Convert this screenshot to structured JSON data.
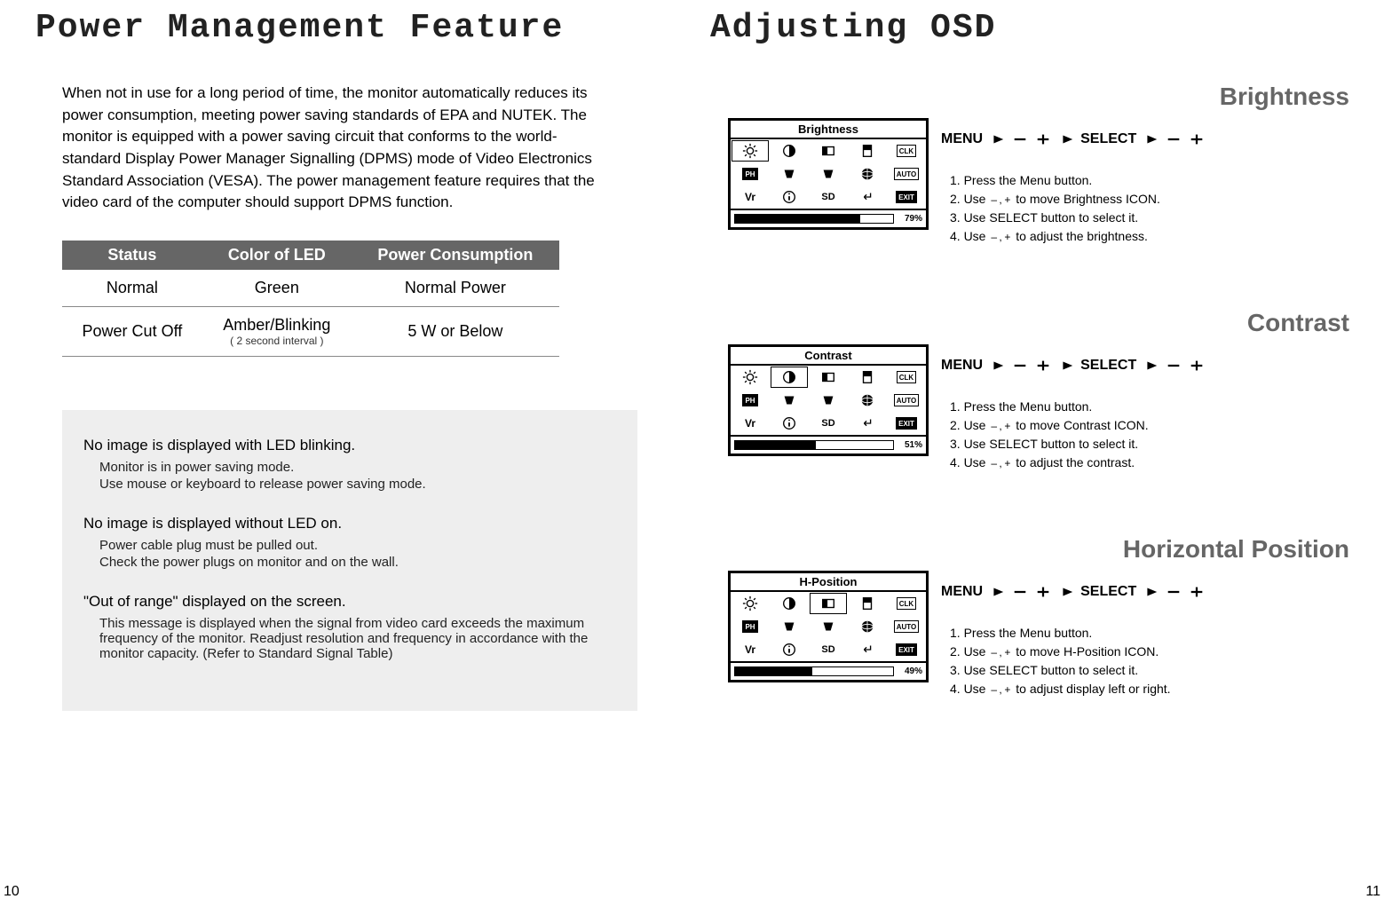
{
  "left": {
    "title": "Power Management Feature",
    "intro": "When not in use for a long period of time, the monitor automatically reduces its power consumption, meeting power saving standards of EPA and NUTEK.\nThe monitor is equipped with a power saving circuit that conforms to the world-standard Display Power Manager Signalling (DPMS) mode of Video Electronics Standard Association (VESA). The power management feature requires that the video card of the computer should support DPMS function.",
    "table": {
      "headers": [
        "Status",
        "Color of LED",
        "Power Consumption"
      ],
      "rows": [
        {
          "status": "Normal",
          "led": "Green",
          "led_sub": "",
          "power": "Normal Power"
        },
        {
          "status": "Power Cut Off",
          "led": "Amber/Blinking",
          "led_sub": "( 2 second interval )",
          "power": "5 W or Below"
        }
      ]
    },
    "troubles": [
      {
        "h": "No image is displayed with LED blinking.",
        "d": [
          "Monitor is in power saving mode.",
          "Use mouse or keyboard to release power saving mode."
        ]
      },
      {
        "h": "No image is displayed without LED on.",
        "d": [
          "Power cable plug must be pulled out.",
          "Check the power plugs on monitor and on the wall."
        ]
      },
      {
        "h": "\"Out of range\" displayed on the screen.",
        "d": [
          "This message is displayed when the signal from video card exceeds the maximum frequency of the monitor. Readjust resolution and frequency in accordance with the monitor capacity. (Refer to Standard Signal Table)"
        ]
      }
    ],
    "pagenum": "10"
  },
  "right": {
    "title": "Adjusting OSD",
    "menu_label": "MENU",
    "select_label": "SELECT",
    "sections": [
      {
        "name": "Brightness",
        "osd_title": "Brightness",
        "percent": 79,
        "steps": [
          "1. Press the Menu button.",
          "2. Use – ,+ to move Brightness ICON.",
          "3. Use SELECT button to select it.",
          "4. Use – ,+ to adjust the brightness."
        ],
        "sel": 0
      },
      {
        "name": "Contrast",
        "osd_title": "Contrast",
        "percent": 51,
        "steps": [
          "1. Press the Menu button.",
          "2. Use – ,+ to move Contrast ICON.",
          "3. Use SELECT button to select it.",
          "4. Use – ,+ to adjust the contrast."
        ],
        "sel": 1
      },
      {
        "name": "Horizontal Position",
        "osd_title": "H-Position",
        "percent": 49,
        "steps": [
          "1. Press the Menu button.",
          "2. Use – ,+ to move  H-Position ICON.",
          "3. Use SELECT button to select it.",
          "4. Use – ,+ to adjust display left or right."
        ],
        "sel": 2
      }
    ],
    "osd_labels": {
      "ph": "PH",
      "vr": "Vr",
      "sd": "SD",
      "clk": "CLK",
      "auto": "AUTO",
      "exit": "EXIT"
    },
    "pagenum": "11"
  }
}
